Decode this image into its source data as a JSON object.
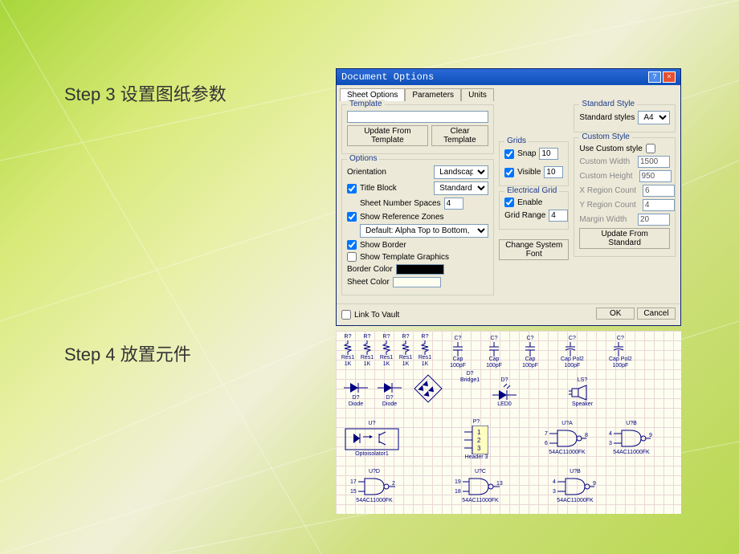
{
  "steps": {
    "step3": "Step 3  设置图纸参数",
    "step4": "Step 4  放置元件"
  },
  "dialog": {
    "title": "Document Options",
    "tabs": [
      "Sheet Options",
      "Parameters",
      "Units"
    ],
    "template": {
      "title": "Template",
      "value": "",
      "update_btn": "Update From Template",
      "clear_btn": "Clear Template"
    },
    "options": {
      "title": "Options",
      "orientation_label": "Orientation",
      "orientation_value": "Landscape",
      "title_block_label": "Title Block",
      "title_block_checked": true,
      "title_block_value": "Standard",
      "sheet_num_label": "Sheet Number Spaces",
      "sheet_num_value": "4",
      "show_ref_label": "Show Reference Zones",
      "show_ref_checked": true,
      "ref_default": "Default: Alpha Top to Bottom,",
      "show_border_label": "Show Border",
      "show_border_checked": true,
      "show_template_label": "Show Template Graphics",
      "show_template_checked": false,
      "border_color_label": "Border Color",
      "border_color": "#000000",
      "sheet_color_label": "Sheet Color",
      "sheet_color": "#fdfdf0"
    },
    "grids": {
      "title": "Grids",
      "snap_label": "Snap",
      "snap_checked": true,
      "snap_value": "10",
      "visible_label": "Visible",
      "visible_checked": true,
      "visible_value": "10"
    },
    "egrid": {
      "title": "Electrical Grid",
      "enable_label": "Enable",
      "enable_checked": true,
      "range_label": "Grid Range",
      "range_value": "4"
    },
    "change_font_btn": "Change System Font",
    "std": {
      "title": "Standard Style",
      "label": "Standard styles",
      "value": "A4"
    },
    "custom": {
      "title": "Custom Style",
      "use_label": "Use Custom style",
      "use_checked": false,
      "width_label": "Custom Width",
      "width_value": "1500",
      "height_label": "Custom Height",
      "height_value": "950",
      "xregion_label": "X Region Count",
      "xregion_value": "6",
      "yregion_label": "Y Region Count",
      "yregion_value": "4",
      "margin_label": "Margin Width",
      "margin_value": "20",
      "update_btn": "Update From Standard"
    },
    "link_vault_label": "Link To Vault",
    "link_vault_checked": false,
    "ok_btn": "OK",
    "cancel_btn": "Cancel"
  },
  "parts": {
    "res": {
      "ref": "R?",
      "name": "Res1",
      "val": "1K"
    },
    "cap": {
      "ref": "C?",
      "name": "Cap",
      "val": "100pF"
    },
    "cappol": {
      "ref": "C?",
      "name": "Cap Pol2",
      "val": "100pF"
    },
    "diode": {
      "ref": "D?",
      "name": "Diode"
    },
    "bridge": {
      "ref": "D?",
      "name": "Bridge1"
    },
    "led": {
      "ref": "D?",
      "name": "LED0"
    },
    "speaker": {
      "ref": "LS?",
      "name": "Speaker"
    },
    "opto": {
      "ref": "U?",
      "name": "Optoisolator1"
    },
    "header": {
      "ref": "P?",
      "name": "Header 3",
      "pins": [
        "1",
        "2",
        "3"
      ]
    },
    "gate_a": {
      "ref": "U?A",
      "name": "54AC11000FK",
      "p1": "7",
      "p2": "6",
      "po": "8"
    },
    "gate_b": {
      "ref": "U?B",
      "name": "54AC11000FK",
      "p1": "4",
      "p2": "3",
      "po": "9"
    },
    "gate_c": {
      "ref": "U?C",
      "name": "54AC11000FK",
      "p1": "19",
      "p2": "18",
      "po": "13"
    },
    "gate_d": {
      "ref": "U?D",
      "name": "54AC11000FK",
      "p1": "17",
      "p2": "15",
      "po": "2"
    }
  }
}
